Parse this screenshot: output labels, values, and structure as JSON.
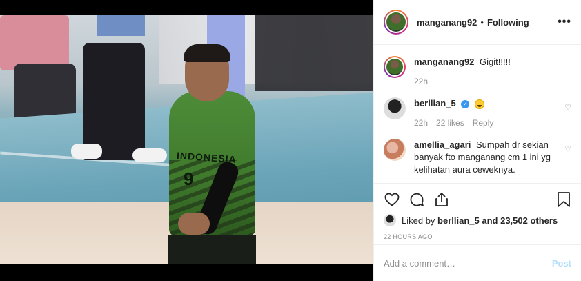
{
  "header": {
    "username": "manganang92",
    "separator": "•",
    "follow_status": "Following",
    "more_icon": "more-horizontal-icon"
  },
  "photo": {
    "jersey_text": "INDONESIA",
    "jersey_number": "9"
  },
  "caption": {
    "username": "manganang92",
    "text": "Gigit!!!!!",
    "time": "22h"
  },
  "comments": [
    {
      "username": "berllian_5",
      "verified": true,
      "text_emoji": "grinning-face-emoji",
      "time": "22h",
      "likes": "22 likes",
      "reply": "Reply"
    },
    {
      "username": "amellia_agari",
      "verified": false,
      "text": "Sumpah dr sekian banyak fto manganang cm 1 ini yg kelihatan aura ceweknya."
    }
  ],
  "actions": {
    "like_icon": "heart-icon",
    "comment_icon": "comment-icon",
    "share_icon": "share-icon",
    "save_icon": "bookmark-icon"
  },
  "likes": {
    "prefix": "Liked by",
    "username": "berllian_5",
    "rest": "and 23,502 others"
  },
  "time_ago": "22 HOURS AGO",
  "add_comment": {
    "placeholder": "Add a comment…",
    "post_label": "Post"
  },
  "colors": {
    "verified": "#3897f0",
    "post_disabled": "#b2dffc",
    "muted": "#8e8e8e"
  }
}
